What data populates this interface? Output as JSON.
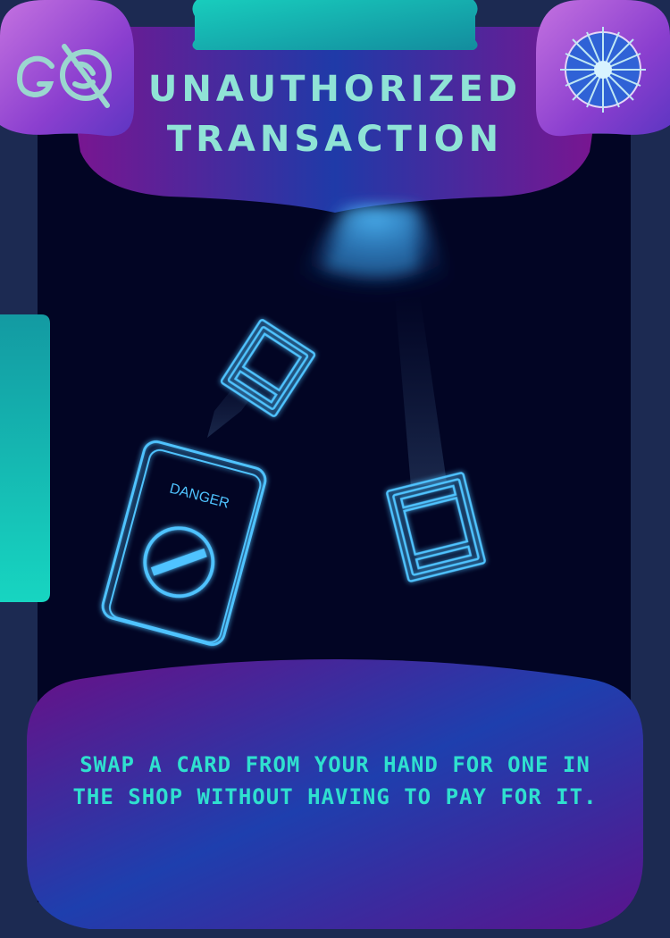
{
  "card": {
    "title_line1": "UNAUTHORIZED",
    "title_line2": "TRANSACTION",
    "description": "SWAP A CARD FROM YOUR HAND FOR ONE IN THE SHOP WITHOUT HAVING TO PAY FOR IT.",
    "danger_label": "DANGER"
  },
  "icons": {
    "left": "no-go-token-icon",
    "right": "compass-star-icon"
  },
  "colors": {
    "frame": "#1c2a52",
    "art_background": "#020524",
    "panel_purple": "#6a1a8c",
    "panel_blue": "#1f3fa8",
    "accent_teal": "#1fd3c4",
    "text_teal": "#2fe0cf",
    "title_teal": "#8fe3d6",
    "neon_blue": "#38b6ff"
  }
}
